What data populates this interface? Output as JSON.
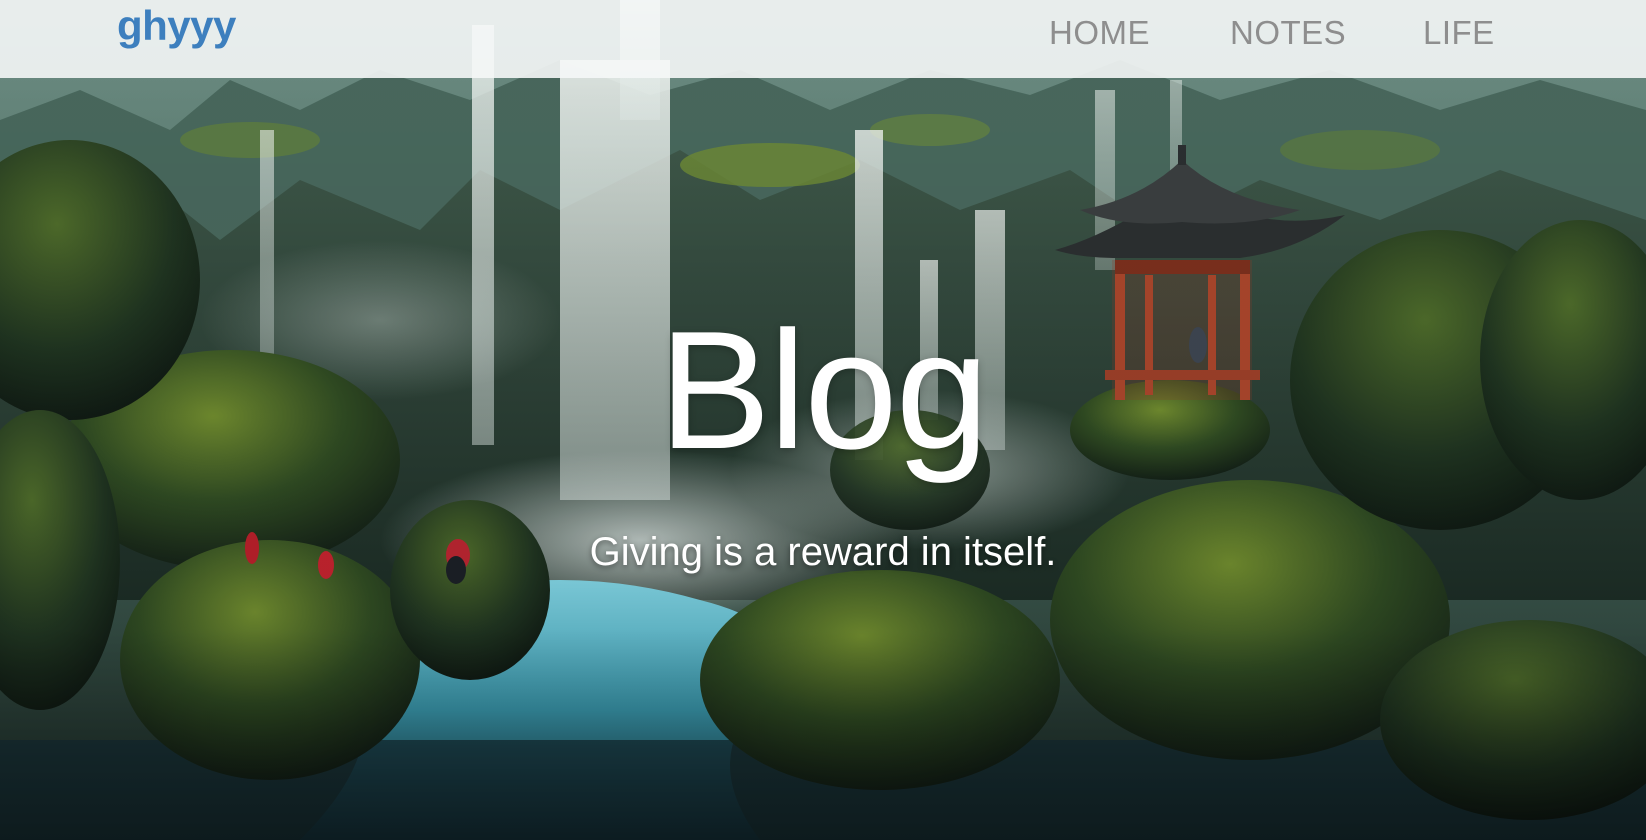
{
  "navbar": {
    "brand": "ghyyy",
    "links": [
      {
        "label": "HOME"
      },
      {
        "label": "NOTES"
      },
      {
        "label": "LIFE"
      }
    ]
  },
  "hero": {
    "title": "Blog",
    "subtitle": "Giving is a reward in itself.",
    "background_image": "painted-waterfall-canyon-with-pagoda"
  },
  "colors": {
    "brand": "#3d7fbe",
    "nav_link": "#8e8e8e",
    "navbar_bg": "#f5f7f7",
    "hero_text": "#ffffff"
  }
}
